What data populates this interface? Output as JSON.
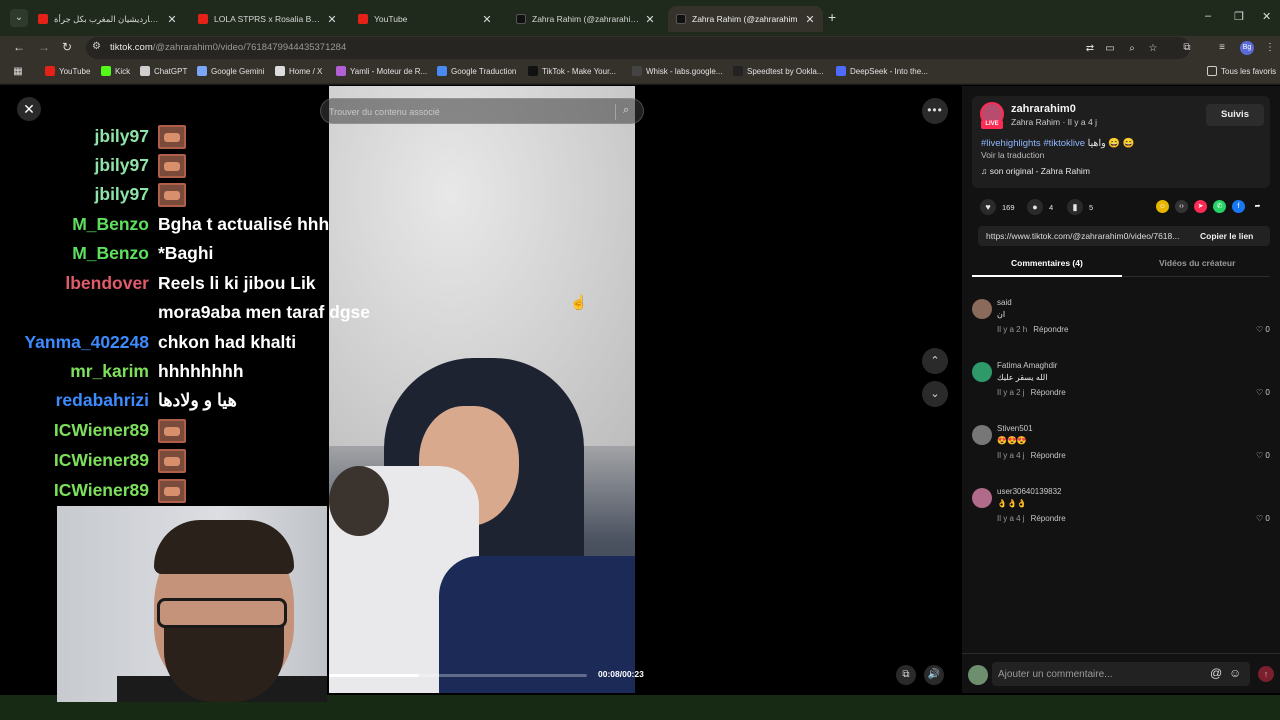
{
  "browser": {
    "tabs": [
      {
        "title": "كيم كارديشيان المغرب بكل جرأة...",
        "type": "youtube",
        "active": false
      },
      {
        "title": "LOLA STPRS x Rosalia BAGDAD",
        "type": "youtube",
        "active": false
      },
      {
        "title": "YouTube",
        "type": "youtube",
        "active": false
      },
      {
        "title": "Zahra Rahim (@zahrarahim0) on",
        "type": "tiktok",
        "active": false
      },
      {
        "title": "Zahra Rahim (@zahrarahim",
        "type": "tiktok",
        "active": true
      }
    ],
    "url_host": "tiktok.com",
    "url_path": "/@zahrarahim0/video/7618479944435371284",
    "profile_initials": "Bg",
    "bookmarks": [
      {
        "label": "YouTube",
        "color": "#e62117"
      },
      {
        "label": "Kick",
        "color": "#53fc18"
      },
      {
        "label": "ChatGPT",
        "color": "#cfcfcf"
      },
      {
        "label": "Google Gemini",
        "color": "#7ba6f7"
      },
      {
        "label": "Home / X",
        "color": "#dddddd"
      },
      {
        "label": "Yamli - Moteur de R...",
        "color": "#b35fd6"
      },
      {
        "label": "Google Traduction",
        "color": "#4a8af4"
      },
      {
        "label": "TikTok - Make Your...",
        "color": "#111111"
      },
      {
        "label": "Whisk - labs.google...",
        "color": "#444444"
      },
      {
        "label": "Speedtest by Ookla...",
        "color": "#222222"
      },
      {
        "label": "DeepSeek - Into the...",
        "color": "#4d6bfe"
      }
    ],
    "all_bookmarks_label": "Tous les favoris"
  },
  "player": {
    "search_placeholder": "Trouver du contenu associé",
    "timecode": "00:08/00:23",
    "progress": 0.35
  },
  "chat": [
    {
      "user": "jbily97",
      "color": "#8fe3a8",
      "msg": "",
      "emote": true
    },
    {
      "user": "jbily97",
      "color": "#8fe3a8",
      "msg": "",
      "emote": true
    },
    {
      "user": "jbily97",
      "color": "#8fe3a8",
      "msg": "",
      "emote": true
    },
    {
      "user": "M_Benzo",
      "color": "#5ee05e",
      "msg": "Bgha t actualisé hhh",
      "emote": false
    },
    {
      "user": "M_Benzo",
      "color": "#5ee05e",
      "msg": "*Baghi",
      "emote": false
    },
    {
      "user": "lbendover",
      "color": "#e05b6b",
      "msg": "Reels li ki jibou Lik",
      "emote": false
    },
    {
      "user": "",
      "color": "#e05b6b",
      "msg": "mora9aba men taraf dgse",
      "emote": false
    },
    {
      "user": "Yanma_402248",
      "color": "#3d8bff",
      "msg": "chkon had khalti",
      "emote": false
    },
    {
      "user": "mr_karim",
      "color": "#7de05a",
      "msg": "hhhhhhhh",
      "emote": false
    },
    {
      "user": "redabahrizi",
      "color": "#3d8bff",
      "msg": "هيا و ولادها",
      "emote": false
    },
    {
      "user": "ICWiener89",
      "color": "#7de05a",
      "msg": "",
      "emote": true
    },
    {
      "user": "ICWiener89",
      "color": "#7de05a",
      "msg": "",
      "emote": true
    },
    {
      "user": "ICWiener89",
      "color": "#7de05a",
      "msg": "",
      "emote": true
    }
  ],
  "panel": {
    "username": "zahrarahim0",
    "subline": "Zahra Rahim · Il y a 4 j",
    "live_label": "LIVE",
    "follow_label": "Suivis",
    "hashtags": "#livehighlights #tiktoklive",
    "caption_tail": "واهيا 😄 😄",
    "translate_label": "Voir la traduction",
    "sound_label": "son original - Zahra Rahim",
    "likes": "169",
    "comments": "4",
    "saves": "5",
    "link": "https://www.tiktok.com/@zahrarahim0/video/7618...",
    "copy_label": "Copier le lien",
    "tab_comments": "Commentaires (4)",
    "tab_creator": "Vidéos du créateur",
    "comment_placeholder": "Ajouter un commentaire...",
    "comments_list": [
      {
        "user": "said",
        "text": "ان",
        "meta": "Il y a 2 h",
        "reply": "Répondre",
        "likes": "0",
        "avatar": "#8a6a5a"
      },
      {
        "user": "Fatima Amaghdir",
        "text": "الله يسقر عليك",
        "meta": "Il y a 2 j",
        "reply": "Répondre",
        "likes": "0",
        "avatar": "#2e9a6a"
      },
      {
        "user": "Stiven501",
        "text": "😍😍😍",
        "meta": "Il y a 4 j",
        "reply": "Répondre",
        "likes": "0",
        "avatar": "#777777"
      },
      {
        "user": "user30640139832",
        "text": "👌👌👌",
        "meta": "Il y a 4 j",
        "reply": "Répondre",
        "likes": "0",
        "avatar": "#b06a8a"
      }
    ]
  }
}
